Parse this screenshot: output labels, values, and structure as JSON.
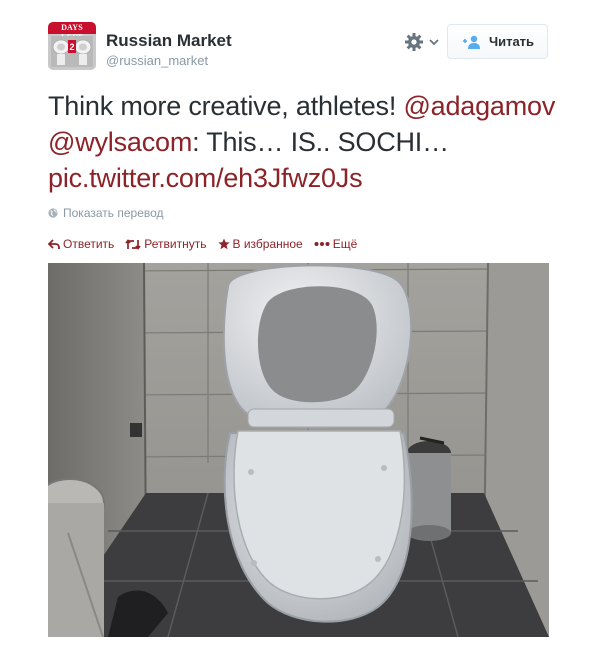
{
  "account": {
    "name": "Russian Market",
    "handle": "@russian_market",
    "avatar_text": "DAYS LEFT"
  },
  "header": {
    "settings_icon": "gear-icon",
    "follow_label": "Читать",
    "follow_icon": "add-user-icon"
  },
  "tweet": {
    "text_lead": "Think more creative, athletes! ",
    "mention_1": "@adagamov",
    "mention_2": "@wylsacom",
    "text_middle": ": This… IS.. SOCHI… ",
    "link": "pic.twitter.com/eh3Jfwz0Js",
    "translate_label": "Показать перевод"
  },
  "actions": {
    "reply": "Ответить",
    "retweet": "Ретвитнуть",
    "favorite": "В избранное",
    "more": "Ещё"
  },
  "colors": {
    "link": "#8b2328",
    "muted": "#8899a6",
    "text": "#292f33",
    "follow_icon": "#55acee"
  }
}
